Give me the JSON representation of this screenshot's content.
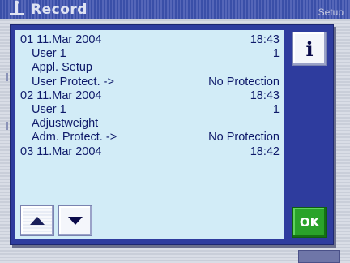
{
  "window": {
    "title": "Record",
    "setup_label": "Setup"
  },
  "dialog": {
    "log": [
      {
        "left": "01 11.Mar 2004",
        "right": "18:43",
        "indent": false
      },
      {
        "left": "User 1",
        "right": "1",
        "indent": true
      },
      {
        "left": "Appl. Setup",
        "right": "",
        "indent": true
      },
      {
        "left": "User Protect. ->",
        "right": "No Protection",
        "indent": true
      },
      {
        "left": "02 11.Mar 2004",
        "right": "18:43",
        "indent": false
      },
      {
        "left": "User 1",
        "right": "1",
        "indent": true
      },
      {
        "left": "Adjustweight",
        "right": "",
        "indent": true
      },
      {
        "left": "Adm. Protect. ->",
        "right": "No Protection",
        "indent": true
      },
      {
        "left": "03 11.Mar 2004",
        "right": "18:42",
        "indent": false
      }
    ],
    "info_label": "i",
    "ok_label": "OK"
  },
  "colors": {
    "dialog_frame": "#2e3c9e",
    "content_bg": "#d2ecf7",
    "text": "#0f1a6a",
    "ok_green": "#2aa32a"
  },
  "icons": {
    "up": "triangle-up-icon",
    "down": "triangle-down-icon",
    "info": "info-icon",
    "app": "balance-icon"
  }
}
